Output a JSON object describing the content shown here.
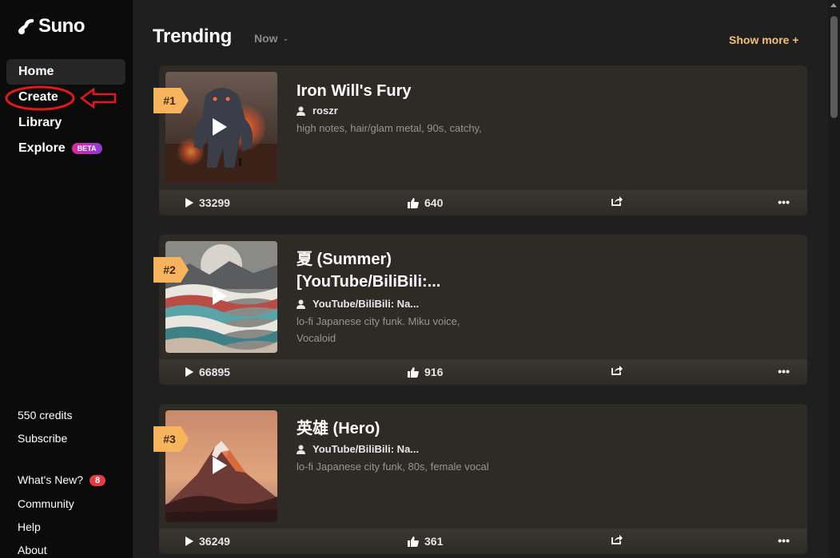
{
  "app": {
    "name": "Suno",
    "accent_color": "#f5c073",
    "annotation_color": "#e11919"
  },
  "sidebar": {
    "nav": [
      {
        "label": "Home",
        "active": true
      },
      {
        "label": "Create",
        "active": false
      },
      {
        "label": "Library",
        "active": false
      },
      {
        "label": "Explore",
        "active": false,
        "badge": "BETA"
      }
    ],
    "credits": "550 credits",
    "subscribe": "Subscribe",
    "whats_new": "What's New?",
    "whats_new_count": "8",
    "community": "Community",
    "help": "Help",
    "about": "About"
  },
  "main": {
    "title": "Trending",
    "period": "Now",
    "show_more": "Show more +",
    "songs": [
      {
        "rank": "#1",
        "title": "Iron Will's Fury",
        "title2": "",
        "author": "roszr",
        "tags": "high notes, hair/glam metal, 90s, catchy,",
        "plays": "33299",
        "likes": "640",
        "cover_icon": "robot-monster-cover"
      },
      {
        "rank": "#2",
        "title": "夏 (Summer)",
        "title2": "[YouTube/BiliBili:...",
        "author": "YouTube/BiliBili: Na...",
        "tags": "lo-fi Japanese city funk. Miku voice, Vocaloid",
        "plays": "66895",
        "likes": "916",
        "cover_icon": "waves-moon-cover"
      },
      {
        "rank": "#3",
        "title": "英雄 (Hero)",
        "title2": "",
        "author": "YouTube/BiliBili: Na...",
        "tags": "lo-fi Japanese city funk, 80s, female vocal",
        "plays": "36249",
        "likes": "361",
        "cover_icon": "mountain-cover"
      }
    ]
  }
}
